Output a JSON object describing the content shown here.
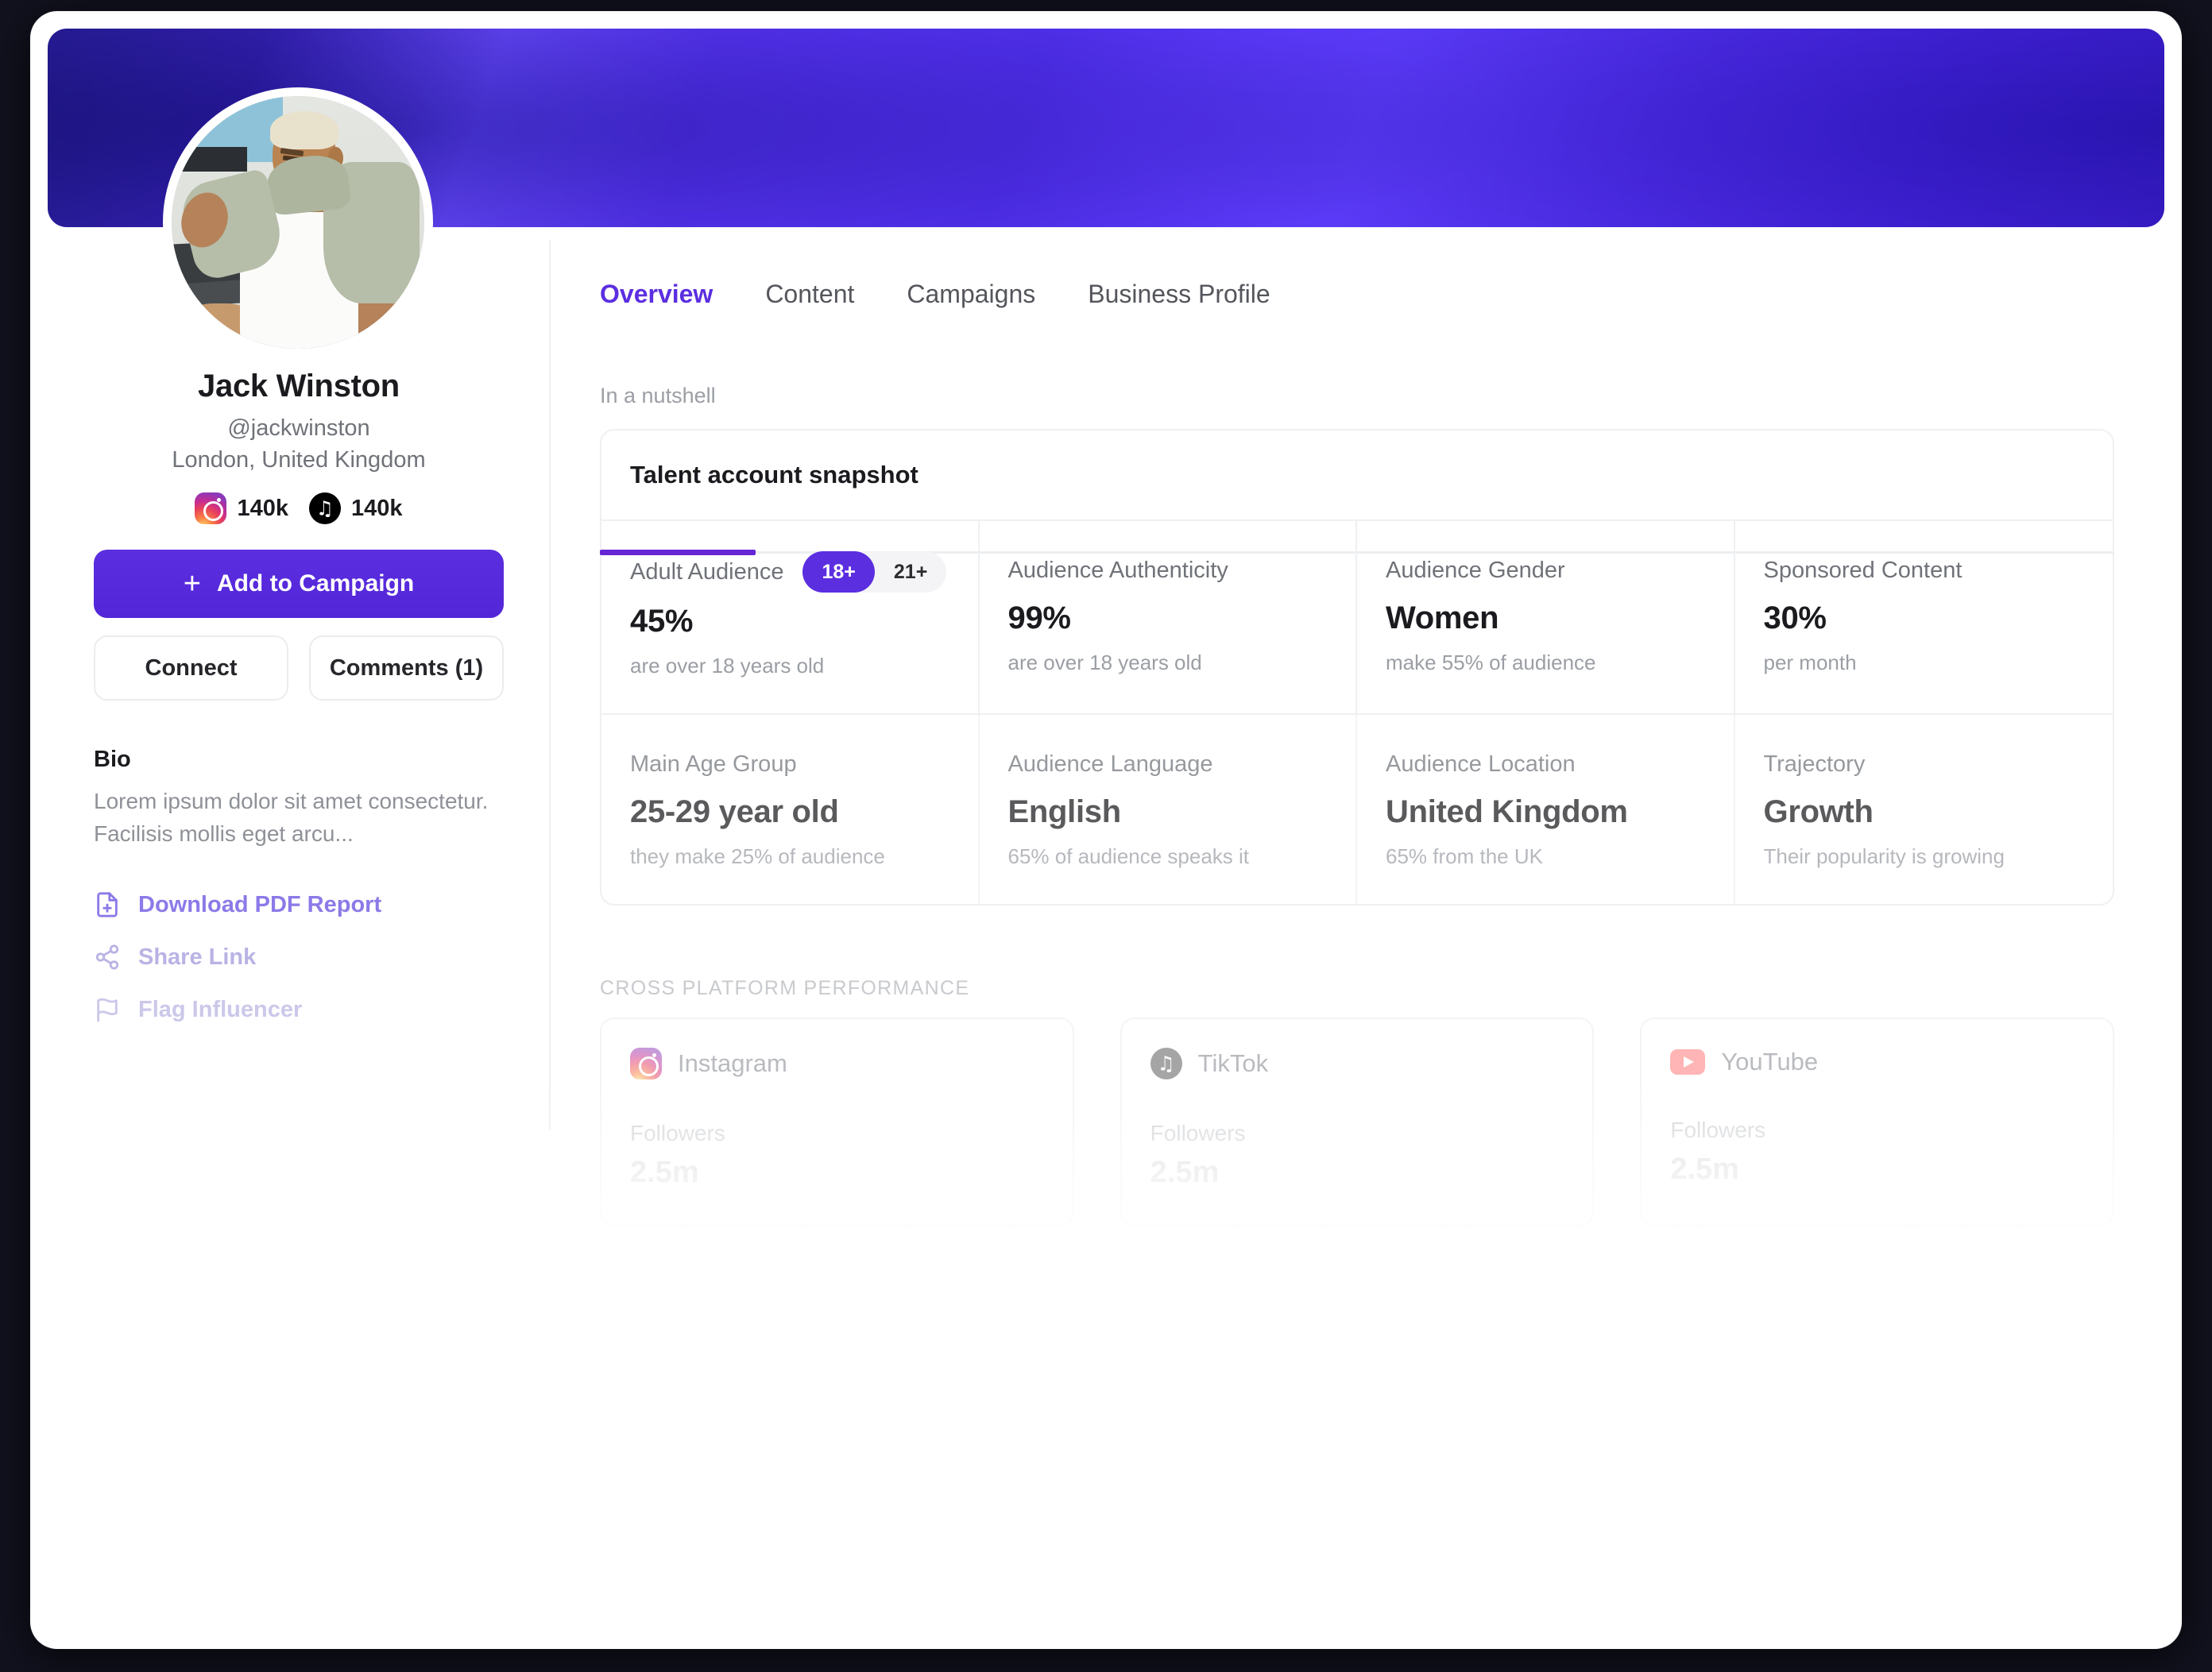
{
  "profile": {
    "name": "Jack Winston",
    "handle": "@jackwinston",
    "location": "London, United Kingdom",
    "socials": [
      {
        "platform": "instagram",
        "count": "140k"
      },
      {
        "platform": "tiktok",
        "count": "140k"
      }
    ],
    "primary_button": "Add to Campaign",
    "secondary_buttons": [
      "Connect",
      "Comments (1)"
    ],
    "bio_title": "Bio",
    "bio_text": "Lorem ipsum dolor sit amet consectetur. Facilisis mollis eget arcu...",
    "links": [
      {
        "label": "Download PDF Report",
        "icon": "file-plus-icon"
      },
      {
        "label": "Share Link",
        "icon": "share-icon"
      },
      {
        "label": "Flag Influencer",
        "icon": "flag-icon"
      }
    ]
  },
  "tabs": [
    {
      "label": "Overview",
      "active": true
    },
    {
      "label": "Content",
      "active": false
    },
    {
      "label": "Campaigns",
      "active": false
    },
    {
      "label": "Business Profile",
      "active": false
    }
  ],
  "overview": {
    "section_label": "In a nutshell",
    "card_title": "Talent account snapshot",
    "age_toggle": {
      "options": [
        "18+",
        "21+"
      ],
      "selected": "18+"
    },
    "stats": [
      {
        "label": "Adult Audience",
        "value": "45%",
        "sub": "are over 18 years old"
      },
      {
        "label": "Audience Authenticity",
        "value": "99%",
        "sub": "are over 18 years old"
      },
      {
        "label": "Audience Gender",
        "value": "Women",
        "sub": "make 55% of audience"
      },
      {
        "label": "Sponsored Content",
        "value": "30%",
        "sub": "per month"
      },
      {
        "label": "Main Age Group",
        "value": "25-29 year old",
        "sub": "they make 25% of audience"
      },
      {
        "label": "Audience Language",
        "value": "English",
        "sub": "65% of audience speaks it"
      },
      {
        "label": "Audience Location",
        "value": "United Kingdom",
        "sub": "65% from the UK"
      },
      {
        "label": "Trajectory",
        "value": "Growth",
        "sub": "Their popularity is growing"
      }
    ]
  },
  "cross_platform": {
    "label": "CROSS PLATFORM PERFORMANCE",
    "cards": [
      {
        "name": "Instagram",
        "icon": "instagram-icon",
        "metric_label": "Followers",
        "metric_value": "2.5m"
      },
      {
        "name": "TikTok",
        "icon": "tiktok-icon",
        "metric_label": "Followers",
        "metric_value": "2.5m"
      },
      {
        "name": "YouTube",
        "icon": "youtube-icon",
        "metric_label": "Followers",
        "metric_value": "2.5m"
      }
    ]
  },
  "colors": {
    "accent": "#5b2ee0",
    "tab_active": "#5b2ee0",
    "banner_from": "#2b1f9e",
    "banner_to": "#6a4cff",
    "page_bg": "#12121f"
  }
}
